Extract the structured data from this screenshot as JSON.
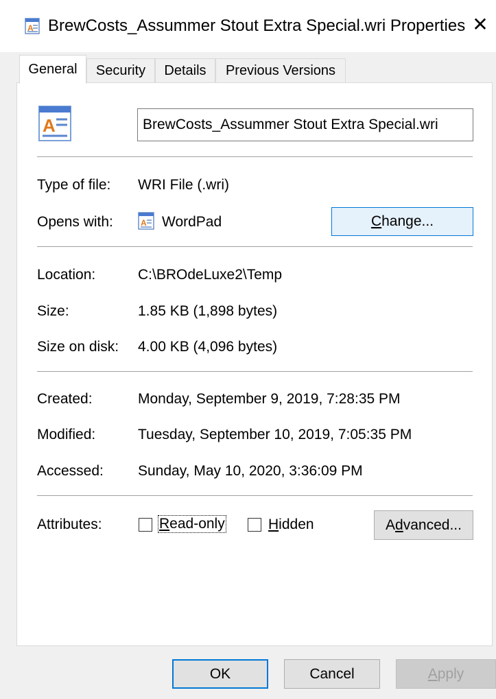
{
  "window": {
    "title": "BrewCosts_Assummer Stout Extra Special.wri Properties",
    "close_glyph": "✕"
  },
  "tabs": [
    {
      "label": "General",
      "active": true
    },
    {
      "label": "Security",
      "active": false
    },
    {
      "label": "Details",
      "active": false
    },
    {
      "label": "Previous Versions",
      "active": false
    }
  ],
  "file": {
    "name": "BrewCosts_Assummer Stout Extra Special.wri",
    "icon": "wordpad-document-icon"
  },
  "type_section": {
    "type_label": "Type of file:",
    "type_value": "WRI File (.wri)",
    "opens_label": "Opens with:",
    "opens_value": "WordPad",
    "opens_icon": "wordpad-app-icon",
    "change_button_pre": "",
    "change_button_accel": "C",
    "change_button_post": "hange..."
  },
  "location_section": {
    "location_label": "Location:",
    "location_value": "C:\\BROdeLuxe2\\Temp",
    "size_label": "Size:",
    "size_value": "1.85 KB (1,898 bytes)",
    "size_on_disk_label": "Size on disk:",
    "size_on_disk_value": "4.00 KB (4,096 bytes)"
  },
  "dates_section": {
    "created_label": "Created:",
    "created_value": "Monday, September 9, 2019, 7:28:35 PM",
    "modified_label": "Modified:",
    "modified_value": "Tuesday, September 10, 2019, 7:05:35 PM",
    "accessed_label": "Accessed:",
    "accessed_value": "Sunday, May 10, 2020, 3:36:09 PM"
  },
  "attributes_section": {
    "label": "Attributes:",
    "readonly_accel": "R",
    "readonly_rest": "ead-only",
    "readonly_checked": false,
    "hidden_accel": "H",
    "hidden_rest": "idden",
    "hidden_checked": false,
    "advanced_pre": "A",
    "advanced_accel": "d",
    "advanced_post": "vanced..."
  },
  "footer": {
    "ok_label": "OK",
    "cancel_label": "Cancel",
    "apply_accel": "A",
    "apply_rest": "pply",
    "apply_enabled": false
  },
  "colors": {
    "accent": "#0078d7",
    "panel_bg": "#ffffff",
    "window_bg": "#f0f0f0"
  }
}
